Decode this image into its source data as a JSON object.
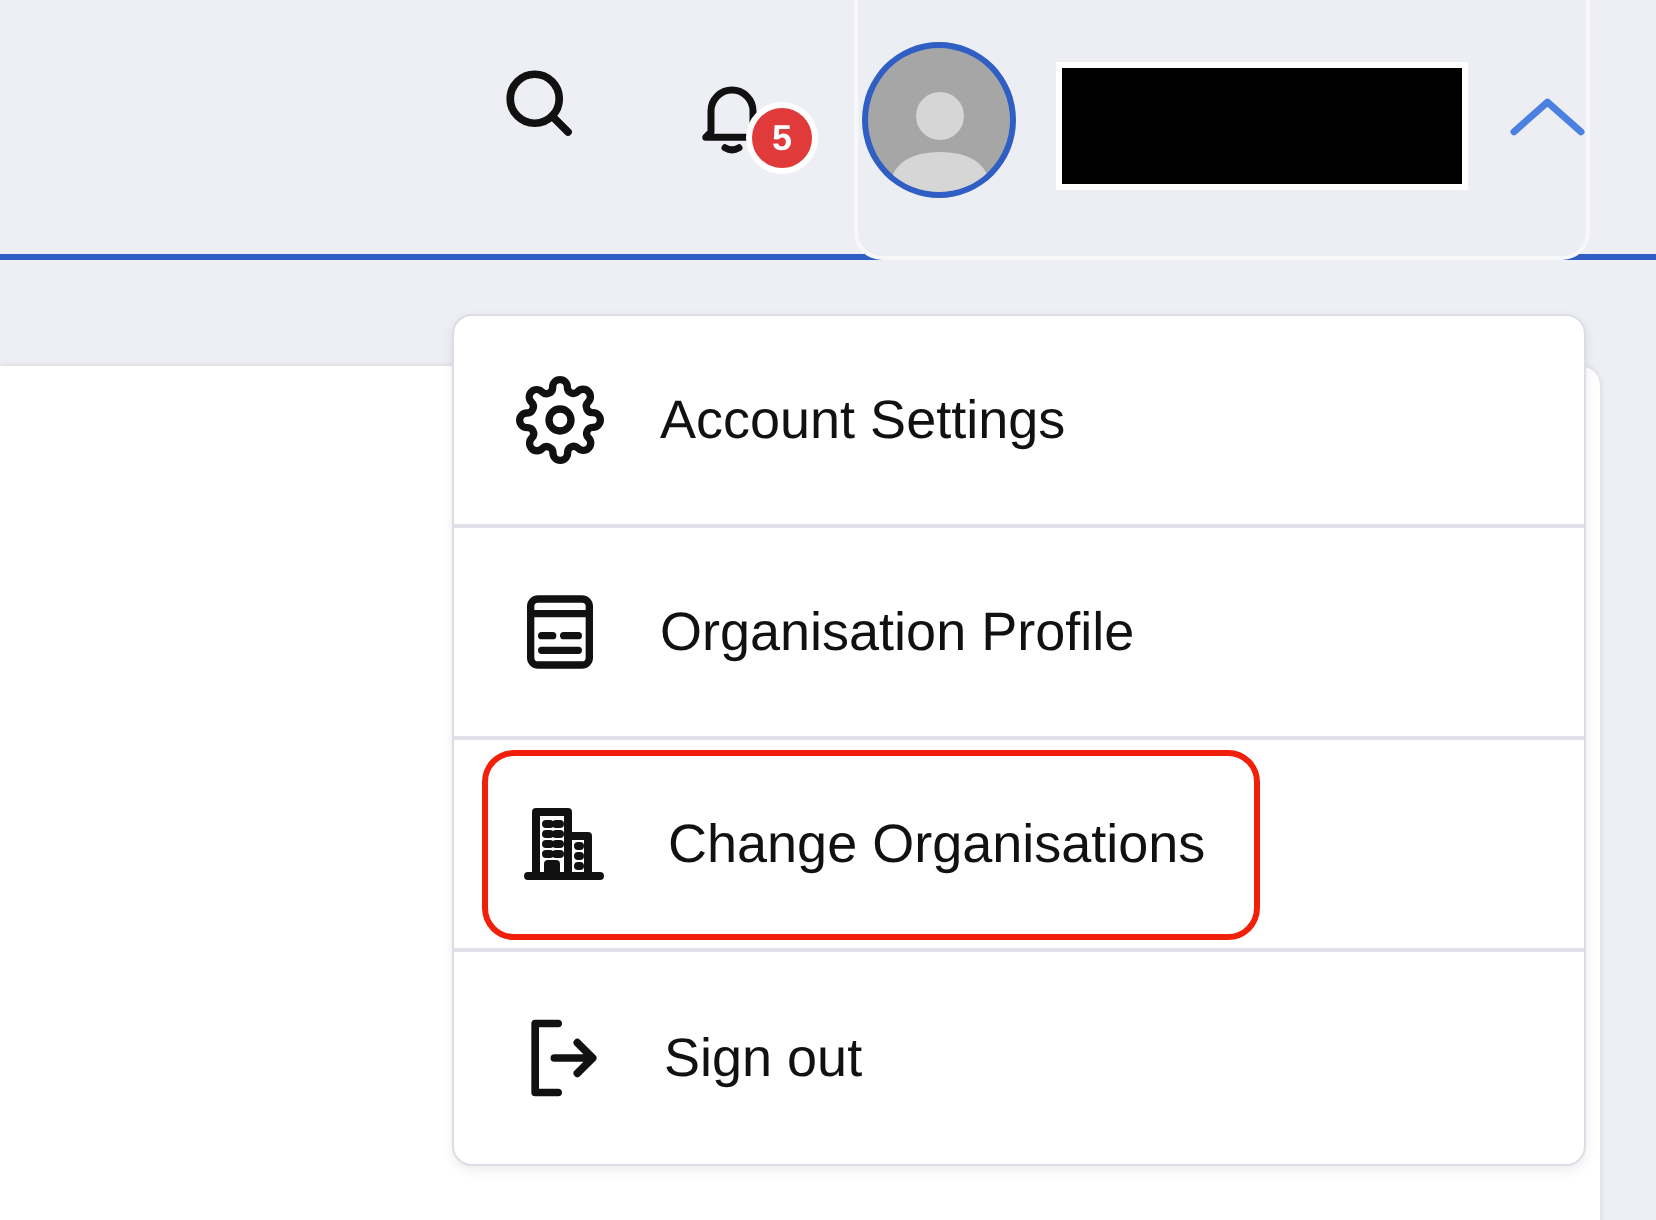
{
  "header": {
    "notifications": {
      "count": "5"
    },
    "account": {
      "expanded": true
    }
  },
  "menu": {
    "items": [
      {
        "kind": "settings",
        "label": "Account Settings",
        "highlighted": false
      },
      {
        "kind": "profile",
        "label": "Organisation Profile",
        "highlighted": false
      },
      {
        "kind": "organisations",
        "label": "Change Organisations",
        "highlighted": true
      },
      {
        "kind": "signout",
        "label": "Sign out",
        "highlighted": false
      }
    ]
  }
}
